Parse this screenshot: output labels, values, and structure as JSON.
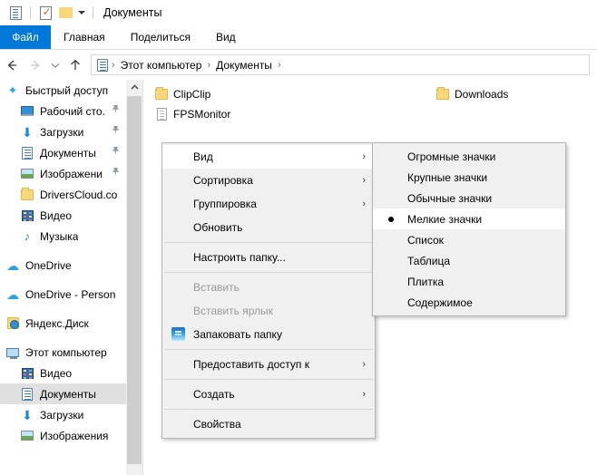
{
  "window": {
    "title": "Документы",
    "quick_access_icons": [
      "properties-icon",
      "new-folder-checked-icon",
      "folder-icon",
      "customize-chevron-icon"
    ]
  },
  "ribbon": {
    "file_tab": "Файл",
    "tabs": [
      "Главная",
      "Поделиться",
      "Вид"
    ]
  },
  "nav": {
    "back_icon": "back-arrow-icon",
    "forward_icon": "forward-arrow-icon",
    "recent_icon": "recent-locations-chevron-icon",
    "up_icon": "up-arrow-icon",
    "address_icon": "documents-icon",
    "crumbs": [
      "Этот компьютер",
      "Документы"
    ],
    "separator": "›"
  },
  "sidebar": {
    "items": [
      {
        "label": "Быстрый доступ",
        "icon": "star-icon",
        "indent": 0,
        "pinned": false,
        "selected": false
      },
      {
        "label": "Рабочий сто.",
        "icon": "desktop-icon",
        "indent": 1,
        "pinned": true,
        "selected": false
      },
      {
        "label": "Загрузки",
        "icon": "download-icon",
        "indent": 1,
        "pinned": true,
        "selected": false
      },
      {
        "label": "Документы",
        "icon": "document-icon",
        "indent": 1,
        "pinned": true,
        "selected": false
      },
      {
        "label": "Изображени",
        "icon": "pictures-icon",
        "indent": 1,
        "pinned": true,
        "selected": false
      },
      {
        "label": "DriversCloud.co",
        "icon": "folder-icon",
        "indent": 1,
        "pinned": false,
        "selected": false
      },
      {
        "label": "Видео",
        "icon": "video-icon",
        "indent": 1,
        "pinned": false,
        "selected": false
      },
      {
        "label": "Музыка",
        "icon": "music-icon",
        "indent": 1,
        "pinned": false,
        "selected": false
      },
      {
        "label": "OneDrive",
        "icon": "cloud-icon",
        "indent": 0,
        "pinned": false,
        "selected": false,
        "gap_before": true
      },
      {
        "label": "OneDrive - Person",
        "icon": "cloud-icon",
        "indent": 0,
        "pinned": false,
        "selected": false,
        "gap_before": true
      },
      {
        "label": "Яндекс.Диск",
        "icon": "yandex-disk-icon",
        "indent": 0,
        "pinned": false,
        "selected": false,
        "gap_before": true
      },
      {
        "label": "Этот компьютер",
        "icon": "this-pc-icon",
        "indent": 0,
        "pinned": false,
        "selected": false,
        "gap_before": true
      },
      {
        "label": "Видео",
        "icon": "video-icon",
        "indent": 1,
        "pinned": false,
        "selected": false
      },
      {
        "label": "Документы",
        "icon": "document-icon",
        "indent": 1,
        "pinned": false,
        "selected": true
      },
      {
        "label": "Загрузки",
        "icon": "download-icon",
        "indent": 1,
        "pinned": false,
        "selected": false
      },
      {
        "label": "Изображения",
        "icon": "pictures-icon",
        "indent": 1,
        "pinned": false,
        "selected": false
      }
    ],
    "scrollbar": {
      "up_arrow": "scroll-up-icon"
    }
  },
  "files": [
    {
      "name": "ClipClip",
      "icon": "folder-icon",
      "col": 0,
      "row": 0
    },
    {
      "name": "FPSMonitor",
      "icon": "document-icon",
      "col": 0,
      "row": 1
    },
    {
      "name": "Downloads",
      "icon": "folder-icon",
      "col": 1,
      "row": 0
    }
  ],
  "context_menu": {
    "items": [
      {
        "label": "Вид",
        "submenu": true,
        "hover": true,
        "disabled": false,
        "icon": null,
        "sep_after": false
      },
      {
        "label": "Сортировка",
        "submenu": true,
        "hover": false,
        "disabled": false,
        "icon": null,
        "sep_after": false
      },
      {
        "label": "Группировка",
        "submenu": true,
        "hover": false,
        "disabled": false,
        "icon": null,
        "sep_after": false
      },
      {
        "label": "Обновить",
        "submenu": false,
        "hover": false,
        "disabled": false,
        "icon": null,
        "sep_after": true
      },
      {
        "label": "Настроить папку...",
        "submenu": false,
        "hover": false,
        "disabled": false,
        "icon": null,
        "sep_after": true
      },
      {
        "label": "Вставить",
        "submenu": false,
        "hover": false,
        "disabled": true,
        "icon": null,
        "sep_after": false
      },
      {
        "label": "Вставить ярлык",
        "submenu": false,
        "hover": false,
        "disabled": true,
        "icon": null,
        "sep_after": false
      },
      {
        "label": "Запаковать папку",
        "submenu": false,
        "hover": false,
        "disabled": false,
        "icon": "zip-icon",
        "sep_after": true
      },
      {
        "label": "Предоставить доступ к",
        "submenu": true,
        "hover": false,
        "disabled": false,
        "icon": null,
        "sep_after": true
      },
      {
        "label": "Создать",
        "submenu": true,
        "hover": false,
        "disabled": false,
        "icon": null,
        "sep_after": true
      },
      {
        "label": "Свойства",
        "submenu": false,
        "hover": false,
        "disabled": false,
        "icon": null,
        "sep_after": false
      }
    ],
    "arrow_glyph": "›"
  },
  "submenu": {
    "items": [
      {
        "label": "Огромные значки",
        "selected": false
      },
      {
        "label": "Крупные значки",
        "selected": false
      },
      {
        "label": "Обычные значки",
        "selected": false
      },
      {
        "label": "Мелкие значки",
        "selected": true
      },
      {
        "label": "Список",
        "selected": false
      },
      {
        "label": "Таблица",
        "selected": false
      },
      {
        "label": "Плитка",
        "selected": false
      },
      {
        "label": "Содержимое",
        "selected": false
      }
    ]
  },
  "colors": {
    "accent": "#0078d7",
    "menu_bg": "#f0f0f0",
    "menu_border": "#b4b4b4",
    "selection": "#e0e0e0",
    "hover": "#ffffff"
  }
}
